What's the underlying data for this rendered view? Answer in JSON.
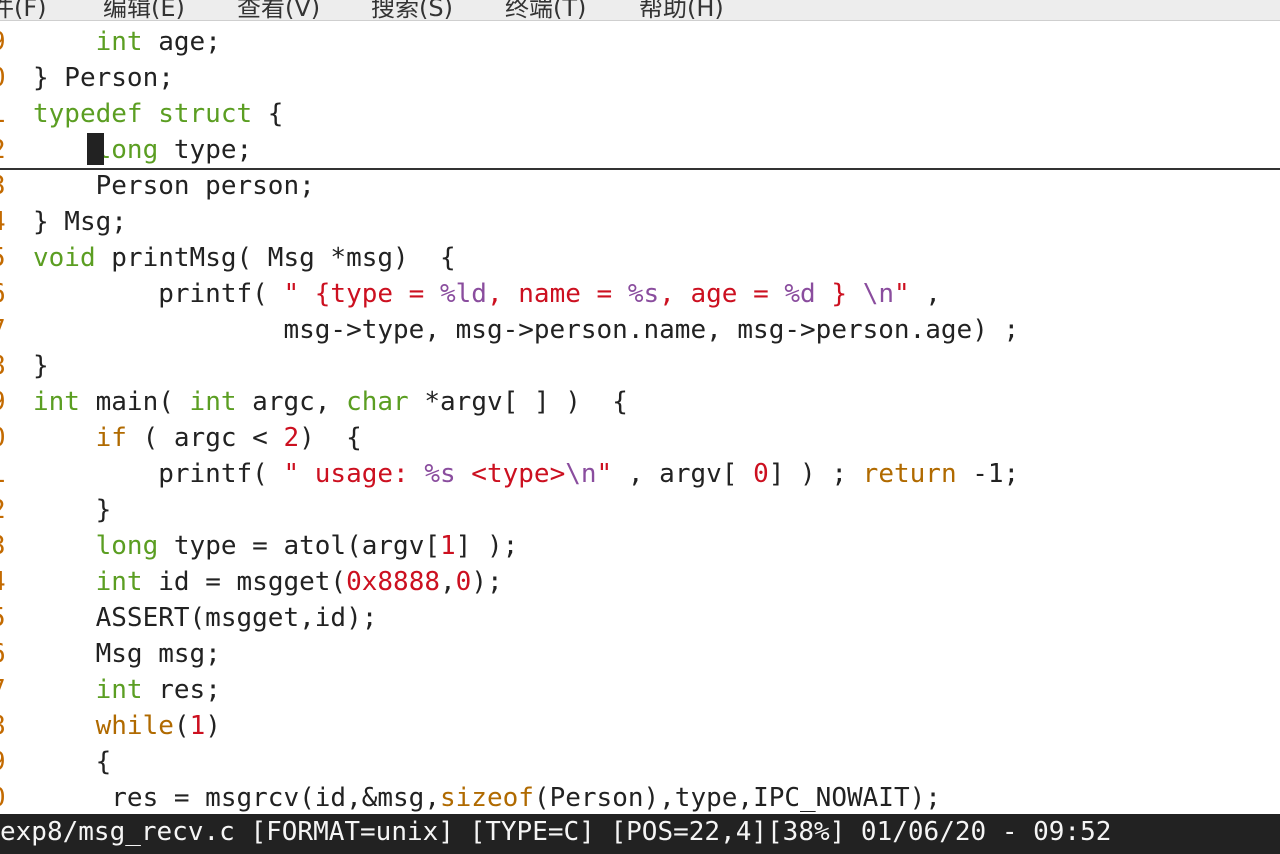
{
  "menubar": {
    "items": [
      "件(F)",
      "编辑(E)",
      "查看(V)",
      "搜索(S)",
      "终端(T)",
      "帮助(H)"
    ]
  },
  "colors": {
    "keyword": "#5b9e22",
    "string": "#cc1020",
    "format": "#8a4d9e",
    "number": "#cc1020",
    "control": "#b06a00",
    "line_number": "#c36a00",
    "default": "#222222"
  },
  "editor": {
    "lines": [
      {
        "ln": "9",
        "tokens": [
          {
            "t": "    ",
            "c": "d"
          },
          {
            "t": "int",
            "c": "kw"
          },
          {
            "t": " age;",
            "c": "d"
          }
        ]
      },
      {
        "ln": "0",
        "tokens": [
          {
            "t": "} Person;",
            "c": "d"
          }
        ]
      },
      {
        "ln": "1",
        "tokens": [
          {
            "t": "typedef struct",
            "c": "kw"
          },
          {
            "t": " {",
            "c": "d"
          }
        ]
      },
      {
        "ln": "2",
        "tokens": [
          {
            "t": "    ",
            "c": "d"
          },
          {
            "t": "long",
            "c": "kw"
          },
          {
            "t": " type;",
            "c": "d"
          }
        ]
      },
      {
        "ln": "3",
        "tokens": [
          {
            "t": "    Person person;",
            "c": "d"
          }
        ]
      },
      {
        "ln": "4",
        "tokens": [
          {
            "t": "} Msg;",
            "c": "d"
          }
        ]
      },
      {
        "ln": "5",
        "tokens": [
          {
            "t": "void",
            "c": "kw"
          },
          {
            "t": " printMsg( Msg *msg)  {",
            "c": "d"
          }
        ]
      },
      {
        "ln": "6",
        "tokens": [
          {
            "t": "        printf( ",
            "c": "d"
          },
          {
            "t": "\" {type = ",
            "c": "str"
          },
          {
            "t": "%ld",
            "c": "fmt"
          },
          {
            "t": ", name = ",
            "c": "str"
          },
          {
            "t": "%s",
            "c": "fmt"
          },
          {
            "t": ", age = ",
            "c": "str"
          },
          {
            "t": "%d",
            "c": "fmt"
          },
          {
            "t": " } ",
            "c": "str"
          },
          {
            "t": "\\n",
            "c": "fmt"
          },
          {
            "t": "\"",
            "c": "str"
          },
          {
            "t": " ,",
            "c": "d"
          }
        ]
      },
      {
        "ln": "7",
        "tokens": [
          {
            "t": "                msg->type, msg->person.name, msg->person.age) ;",
            "c": "d"
          }
        ]
      },
      {
        "ln": "8",
        "tokens": [
          {
            "t": "}",
            "c": "d"
          }
        ]
      },
      {
        "ln": "9",
        "tokens": [
          {
            "t": "int",
            "c": "kw"
          },
          {
            "t": " main( ",
            "c": "d"
          },
          {
            "t": "int",
            "c": "kw"
          },
          {
            "t": " argc, ",
            "c": "d"
          },
          {
            "t": "char",
            "c": "kw"
          },
          {
            "t": " *argv[ ] )  {",
            "c": "d"
          }
        ]
      },
      {
        "ln": "0",
        "tokens": [
          {
            "t": "    ",
            "c": "d"
          },
          {
            "t": "if",
            "c": "ctl"
          },
          {
            "t": " ( argc < ",
            "c": "d"
          },
          {
            "t": "2",
            "c": "num"
          },
          {
            "t": ")  {",
            "c": "d"
          }
        ]
      },
      {
        "ln": "1",
        "tokens": [
          {
            "t": "        printf( ",
            "c": "d"
          },
          {
            "t": "\" usage: ",
            "c": "str"
          },
          {
            "t": "%s",
            "c": "fmt"
          },
          {
            "t": " <type>",
            "c": "str"
          },
          {
            "t": "\\n",
            "c": "fmt"
          },
          {
            "t": "\"",
            "c": "str"
          },
          {
            "t": " , argv[ ",
            "c": "d"
          },
          {
            "t": "0",
            "c": "num"
          },
          {
            "t": "] ) ; ",
            "c": "d"
          },
          {
            "t": "return",
            "c": "ctl"
          },
          {
            "t": " -1;",
            "c": "d"
          }
        ]
      },
      {
        "ln": "2",
        "tokens": [
          {
            "t": "    }",
            "c": "d"
          }
        ]
      },
      {
        "ln": "3",
        "tokens": [
          {
            "t": "    ",
            "c": "d"
          },
          {
            "t": "long",
            "c": "kw"
          },
          {
            "t": " type = atol(argv[",
            "c": "d"
          },
          {
            "t": "1",
            "c": "num"
          },
          {
            "t": "] );",
            "c": "d"
          }
        ]
      },
      {
        "ln": "4",
        "tokens": [
          {
            "t": "    ",
            "c": "d"
          },
          {
            "t": "int",
            "c": "kw"
          },
          {
            "t": " id = msgget(",
            "c": "d"
          },
          {
            "t": "0x8888",
            "c": "num"
          },
          {
            "t": ",",
            "c": "d"
          },
          {
            "t": "0",
            "c": "num"
          },
          {
            "t": ");",
            "c": "d"
          }
        ]
      },
      {
        "ln": "5",
        "tokens": [
          {
            "t": "    ASSERT(msgget,id);",
            "c": "d"
          }
        ]
      },
      {
        "ln": "6",
        "tokens": [
          {
            "t": "    Msg msg;",
            "c": "d"
          }
        ]
      },
      {
        "ln": "7",
        "tokens": [
          {
            "t": "    ",
            "c": "d"
          },
          {
            "t": "int",
            "c": "kw"
          },
          {
            "t": " res;",
            "c": "d"
          }
        ]
      },
      {
        "ln": "8",
        "tokens": [
          {
            "t": "    ",
            "c": "d"
          },
          {
            "t": "while",
            "c": "ctl"
          },
          {
            "t": "(",
            "c": "d"
          },
          {
            "t": "1",
            "c": "num"
          },
          {
            "t": ")",
            "c": "d"
          }
        ]
      },
      {
        "ln": "9",
        "tokens": [
          {
            "t": "    {",
            "c": "d"
          }
        ]
      },
      {
        "ln": "0",
        "tokens": [
          {
            "t": "     res = msgrcv(id,&msg,",
            "c": "d"
          },
          {
            "t": "sizeof",
            "c": "ctl"
          },
          {
            "t": "(Person),type,IPC_NOWAIT);",
            "c": "d"
          }
        ]
      }
    ],
    "cursor_line_index": 3
  },
  "statusbar": {
    "text": "exp8/msg_recv.c [FORMAT=unix] [TYPE=C] [POS=22,4][38%] 01/06/20 - 09:52"
  }
}
